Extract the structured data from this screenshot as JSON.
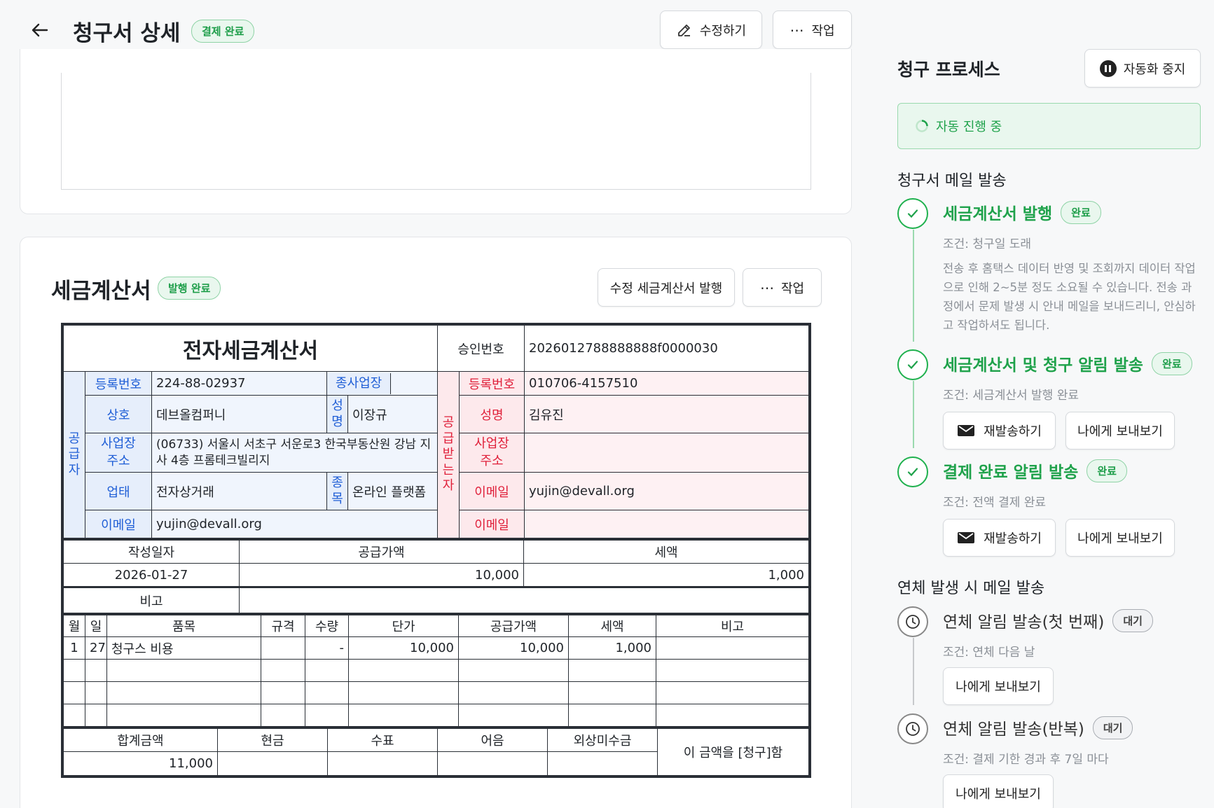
{
  "header": {
    "title": "청구서 상세",
    "status": "결제 완료",
    "edit_label": "수정하기",
    "action_label": "작업"
  },
  "tax_section": {
    "title": "세금계산서",
    "status": "발행 완료",
    "reissue_label": "수정 세금계산서 발행",
    "action_label": "작업"
  },
  "invoice": {
    "title": "전자세금계산서",
    "approval_label": "승인번호",
    "approval_no": "2026012788888888f0000030",
    "supplier": {
      "side_label": "공급자",
      "reg_label": "등록번호",
      "reg_no": "224-88-02937",
      "branch_label": "종사업장",
      "name_label": "상호",
      "name": "데브올컴퍼니",
      "rep_label": "성명",
      "rep": "이장규",
      "addr_label": "사업장 주소",
      "addr": "(06733) 서울시 서초구 서운로3 한국부동산원 강남 지사 4층 프롬테크빌리지",
      "biz_label": "업태",
      "biz": "전자상거래",
      "item_label": "종목",
      "item": "온라인 플랫폼",
      "email_label": "이메일",
      "email": "yujin@devall.org"
    },
    "receiver": {
      "side_label": "공급받는자",
      "reg_label": "등록번호",
      "reg_no": "010706-4157510",
      "name_label": "성명",
      "name": "김유진",
      "addr_label": "사업장 주소",
      "addr": "",
      "email_label": "이메일",
      "email": "yujin@devall.org",
      "email2_label": "이메일",
      "email2": ""
    },
    "summary": {
      "date_label": "작성일자",
      "supply_label": "공급가액",
      "tax_label": "세액",
      "date": "2026-01-27",
      "supply": "10,000",
      "tax": "1,000",
      "note_label": "비고",
      "note": ""
    },
    "items_header": [
      "월",
      "일",
      "품목",
      "규격",
      "수량",
      "단가",
      "공급가액",
      "세액",
      "비고"
    ],
    "items": [
      [
        "1",
        "27",
        "청구스 비용",
        "",
        "-",
        "10,000",
        "10,000",
        "1,000",
        ""
      ],
      [
        "",
        "",
        "",
        "",
        "",
        "",
        "",
        "",
        ""
      ],
      [
        "",
        "",
        "",
        "",
        "",
        "",
        "",
        "",
        ""
      ],
      [
        "",
        "",
        "",
        "",
        "",
        "",
        "",
        "",
        ""
      ]
    ],
    "totals": {
      "headers": [
        "합계금액",
        "현금",
        "수표",
        "어음",
        "외상미수금"
      ],
      "values": [
        "11,000",
        "",
        "",
        "",
        ""
      ],
      "claim": "이 금액을 [청구]함"
    }
  },
  "panel": {
    "title": "청구 프로세스",
    "stop_label": "자동화 중지",
    "auto_status": "자동 진행 중",
    "group1": "청구서 메일 발송",
    "steps1": [
      {
        "title": "세금계산서 발행",
        "badge": "완료",
        "cond": "조건: 청구일 도래",
        "desc": "전송 후 홈택스 데이터 반영 및 조회까지 데이터 작업으로 인해 2~5분 정도 소요될 수 있습니다. 전송 과정에서 문제 발생 시 안내 메일을 보내드리니, 안심하고 작업하셔도 됩니다."
      },
      {
        "title": "세금계산서 및 청구 알림 발송",
        "badge": "완료",
        "cond": "조건: 세금계산서 발행 완료",
        "resend": "재발송하기",
        "self": "나에게 보내보기"
      },
      {
        "title": "결제 완료 알림 발송",
        "badge": "완료",
        "cond": "조건: 전액 결제 완료",
        "resend": "재발송하기",
        "self": "나에게 보내보기"
      }
    ],
    "group2": "연체 발생 시 메일 발송",
    "steps2": [
      {
        "title": "연체 알림 발송(첫 번째)",
        "badge": "대기",
        "cond": "조건: 연체 다음 날",
        "self": "나에게 보내보기"
      },
      {
        "title": "연체 알림 발송(반복)",
        "badge": "대기",
        "cond": "조건: 결제 기한 경과 후 7일 마다",
        "self": "나에게 보내보기"
      }
    ]
  },
  "colors": {
    "accent_green": "#1fa24b",
    "supplier_blue": "#1f5ed6",
    "receiver_red": "#e0203a"
  }
}
